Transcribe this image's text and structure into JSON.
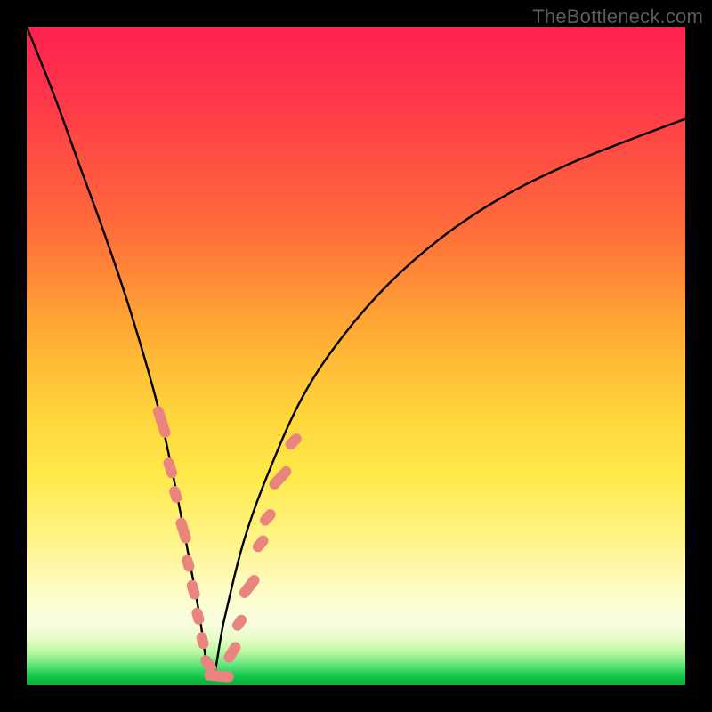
{
  "watermark": "TheBottleneck.com",
  "colors": {
    "frame": "#000000",
    "curve": "#000000",
    "marker_fill": "#e9857e",
    "marker_stroke": "#d46b64"
  },
  "chart_data": {
    "type": "line",
    "title": "",
    "xlabel": "",
    "ylabel": "",
    "xlim": [
      0,
      100
    ],
    "ylim": [
      0,
      100
    ],
    "note": "Axes are unlabeled in the image; values are estimated as percent of plot width/height (0 = left/bottom, 100 = right/top). The black curve is a V-shaped bottleneck curve touching ~0 at x≈28. Pink capsule markers lie along the lower limbs of the V.",
    "series": [
      {
        "name": "bottleneck-curve",
        "x": [
          0,
          4,
          8,
          12,
          16,
          20,
          23,
          26,
          28,
          30,
          33,
          37,
          42,
          48,
          55,
          63,
          72,
          82,
          92,
          100
        ],
        "y": [
          100,
          90,
          79,
          68,
          56,
          42,
          28,
          12,
          1,
          10,
          22,
          33,
          44,
          53,
          61,
          68,
          74,
          79,
          83,
          86
        ]
      }
    ],
    "markers": {
      "name": "highlight-capsules",
      "shape": "capsule",
      "points": [
        {
          "x": 20.5,
          "y": 40.0,
          "angle_deg": 72,
          "len": 5.0
        },
        {
          "x": 21.8,
          "y": 33.0,
          "angle_deg": 72,
          "len": 3.2
        },
        {
          "x": 22.6,
          "y": 29.0,
          "angle_deg": 72,
          "len": 2.6
        },
        {
          "x": 23.8,
          "y": 23.5,
          "angle_deg": 73,
          "len": 4.0
        },
        {
          "x": 24.5,
          "y": 18.5,
          "angle_deg": 73,
          "len": 2.6
        },
        {
          "x": 25.3,
          "y": 14.5,
          "angle_deg": 74,
          "len": 3.0
        },
        {
          "x": 26.0,
          "y": 10.5,
          "angle_deg": 75,
          "len": 2.6
        },
        {
          "x": 26.7,
          "y": 6.8,
          "angle_deg": 76,
          "len": 2.6
        },
        {
          "x": 27.6,
          "y": 3.2,
          "angle_deg": 55,
          "len": 3.0
        },
        {
          "x": 29.2,
          "y": 1.4,
          "angle_deg": 5,
          "len": 4.5
        },
        {
          "x": 31.2,
          "y": 5.0,
          "angle_deg": -58,
          "len": 3.4
        },
        {
          "x": 32.3,
          "y": 9.5,
          "angle_deg": -55,
          "len": 2.6
        },
        {
          "x": 33.8,
          "y": 15.0,
          "angle_deg": -52,
          "len": 4.0
        },
        {
          "x": 35.5,
          "y": 21.5,
          "angle_deg": -50,
          "len": 2.8
        },
        {
          "x": 36.6,
          "y": 25.5,
          "angle_deg": -49,
          "len": 2.8
        },
        {
          "x": 38.5,
          "y": 31.5,
          "angle_deg": -47,
          "len": 4.2
        },
        {
          "x": 40.5,
          "y": 37.0,
          "angle_deg": -45,
          "len": 2.8
        }
      ]
    }
  }
}
